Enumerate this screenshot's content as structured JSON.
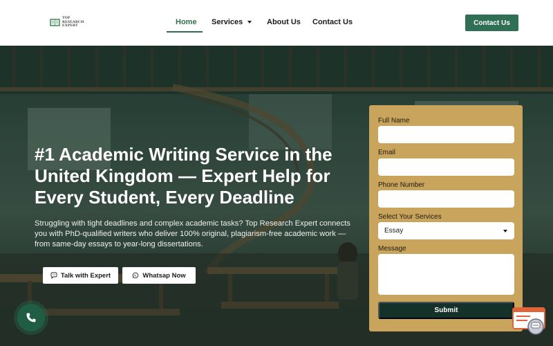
{
  "header": {
    "logo_lines": [
      "TOP",
      "RESEARCH",
      "EXPERT"
    ],
    "nav": [
      {
        "label": "Home",
        "active": true
      },
      {
        "label": "Services",
        "has_dropdown": true
      },
      {
        "label": "About Us"
      },
      {
        "label": "Contact Us"
      }
    ],
    "cta_label": "Contact Us"
  },
  "hero": {
    "title": "#1 Academic Writing Service in the United Kingdom — Expert Help for Every Student, Every Deadline",
    "subtitle": "Struggling with tight deadlines and complex academic tasks? Top Research Expert connects you with PhD-qualified writers who deliver 100% original, plagiarism-free academic work — from same-day essays to year-long dissertations.",
    "buttons": {
      "talk": "Talk with Expert",
      "whatsapp": "Whatsap Now"
    }
  },
  "form": {
    "full_name_label": "Full Name",
    "email_label": "Email",
    "phone_label": "Phone Number",
    "services_label": "Select Your Services",
    "services_selected": "Essay",
    "message_label": "Message",
    "submit_label": "Submit"
  },
  "colors": {
    "brand_green": "#2f6f56",
    "form_bg": "#c8a45c",
    "submit_bg": "#15322a"
  },
  "icons": {
    "talk": "chat-bubble-icon",
    "whatsapp": "whatsapp-icon",
    "call": "phone-icon",
    "chat": "chat-widget-icon"
  }
}
